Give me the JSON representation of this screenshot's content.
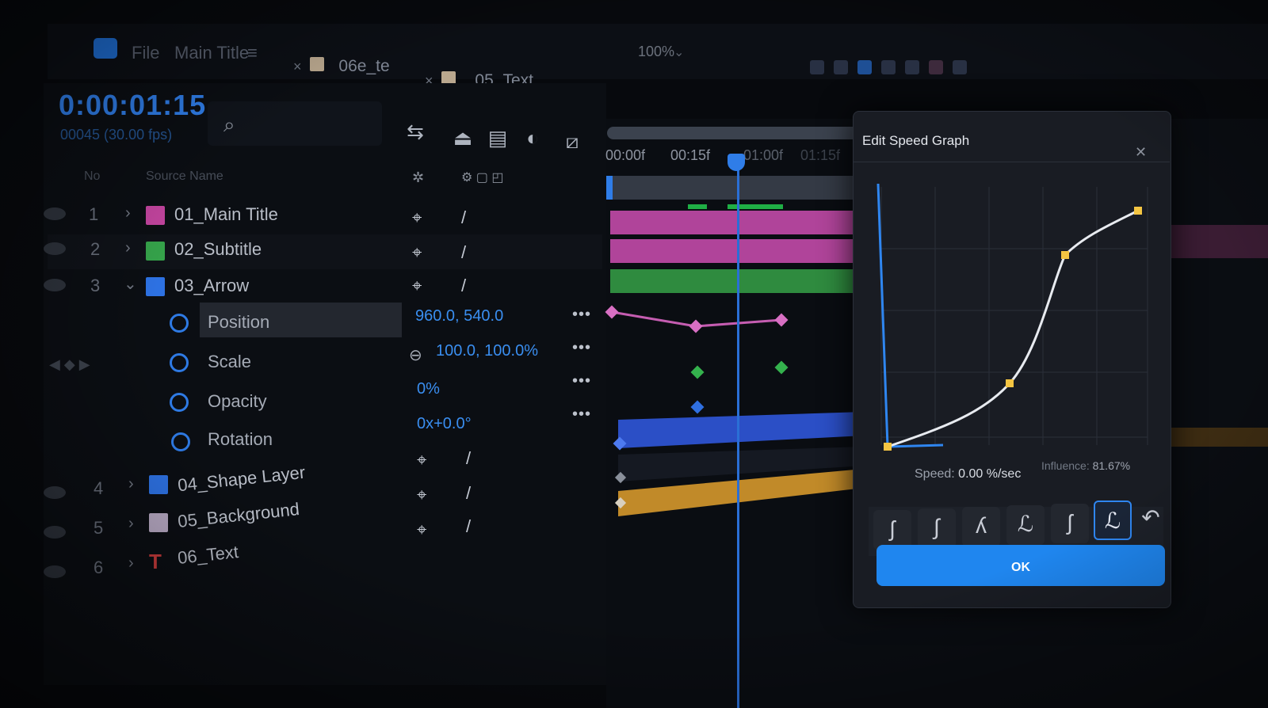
{
  "app": {
    "menu": [
      "File",
      "Main Title"
    ],
    "tabs": [
      {
        "label": "06e_te"
      },
      {
        "label": "05_Text"
      }
    ],
    "zoom": "100%"
  },
  "left_panel": {
    "timecode": "0:00:01:15",
    "timecode_sub": "00045 (30.00 fps)",
    "columns": {
      "num": "No",
      "source": "Source Name"
    },
    "layers": [
      {
        "num": "1",
        "name": "01_Main Title",
        "color": "#c1449d"
      },
      {
        "num": "2",
        "name": "02_Subtitle",
        "color": "#35a24a"
      },
      {
        "num": "3",
        "name": "03_Arrow",
        "color": "#2d71e2"
      },
      {
        "num": "4",
        "name": "04_Shape Layer",
        "color": "#2d71e2"
      },
      {
        "num": "5",
        "name": "05_Background",
        "color": "#b7a9c3"
      },
      {
        "num": "6",
        "name": "06_Text",
        "color": "#c73b3b"
      }
    ],
    "properties": [
      {
        "name": "Position",
        "value": "960.0, 540.0"
      },
      {
        "name": "Scale",
        "value": "100.0, 100.0%"
      },
      {
        "name": "Opacity",
        "value": "0%"
      },
      {
        "name": "Rotation",
        "value": "0x+0.0°"
      }
    ]
  },
  "timeline": {
    "ruler": [
      "00:00f",
      "00:15f",
      "01:00f",
      "01:15f"
    ]
  },
  "dialog": {
    "title": "Edit Speed Graph",
    "speed_label": "Speed:",
    "speed_value": "0.00 %/sec",
    "influence_label": "Influence:",
    "influence_value": "81.67%",
    "ok_label": "OK",
    "presets": [
      "preset-1",
      "preset-2",
      "preset-3",
      "preset-4",
      "preset-5",
      "preset-6",
      "preset-7"
    ],
    "active_preset_index": 5
  },
  "colors": {
    "accent": "#2f7de8",
    "pink_track": "#b0449a",
    "green_track": "#2f8b3f",
    "blue_track": "#2b4fc6",
    "yellow_track": "#c18a29"
  }
}
